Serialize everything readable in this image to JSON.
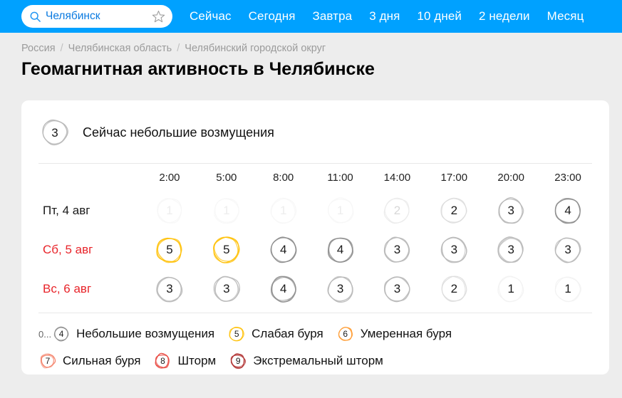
{
  "topbar": {
    "search": {
      "value": "Челябинск",
      "placeholder": "Поиск города",
      "icon": "search-icon",
      "favorite_icon": "star-icon"
    },
    "nav": [
      {
        "label": "Сейчас"
      },
      {
        "label": "Сегодня"
      },
      {
        "label": "Завтра"
      },
      {
        "label": "3 дня"
      },
      {
        "label": "10 дней"
      },
      {
        "label": "2 недели"
      },
      {
        "label": "Месяц"
      }
    ],
    "bg_color": "#00A1FF"
  },
  "breadcrumb": {
    "items": [
      {
        "label": "Россия"
      },
      {
        "label": "Челябинская область"
      },
      {
        "label": "Челябинский городской округ"
      }
    ],
    "separator": "/"
  },
  "page": {
    "title": "Геомагнитная активность в Челябинске"
  },
  "card": {
    "status": {
      "value": "3",
      "text": "Сейчас небольшие возмущения"
    },
    "time_columns": [
      "2:00",
      "5:00",
      "8:00",
      "11:00",
      "14:00",
      "17:00",
      "20:00",
      "23:00"
    ],
    "rows": [
      {
        "day": "Пт, 4 авг",
        "is_weekend": false,
        "values": [
          "1",
          "1",
          "1",
          "1",
          "2",
          "2",
          "3",
          "4"
        ],
        "past": [
          true,
          true,
          true,
          true,
          true,
          false,
          false,
          false
        ]
      },
      {
        "day": "Сб, 5 авг",
        "is_weekend": true,
        "values": [
          "5",
          "5",
          "4",
          "4",
          "3",
          "3",
          "3",
          "3"
        ],
        "past": [
          false,
          false,
          false,
          false,
          false,
          false,
          false,
          false
        ]
      },
      {
        "day": "Вс, 6 авг",
        "is_weekend": true,
        "values": [
          "3",
          "3",
          "4",
          "3",
          "3",
          "2",
          "1",
          "1"
        ],
        "past": [
          false,
          false,
          false,
          false,
          false,
          false,
          false,
          false
        ]
      }
    ]
  },
  "legend": {
    "rows": [
      [
        {
          "prefix": "0...",
          "value": "4",
          "label": "Небольшие возмущения"
        },
        {
          "prefix": "",
          "value": "5",
          "label": "Слабая буря"
        },
        {
          "prefix": "",
          "value": "6",
          "label": "Умеренная буря"
        }
      ],
      [
        {
          "prefix": "",
          "value": "7",
          "label": "Сильная буря"
        },
        {
          "prefix": "",
          "value": "8",
          "label": "Шторм"
        },
        {
          "prefix": "",
          "value": "9",
          "label": "Экстремальный шторм"
        }
      ]
    ]
  },
  "colors": {
    "accent": "#00A1FF",
    "weekend": "#e8242a",
    "level_1": "#f2f2f2",
    "level_2": "#dcdcdc",
    "level_3": "#b8b8b8",
    "level_4": "#8e8e8e",
    "level_5": "#FFC107",
    "level_6": "#FF9A2E",
    "level_7": "#F4836B",
    "level_8": "#E8473F",
    "level_9": "#B03030"
  }
}
